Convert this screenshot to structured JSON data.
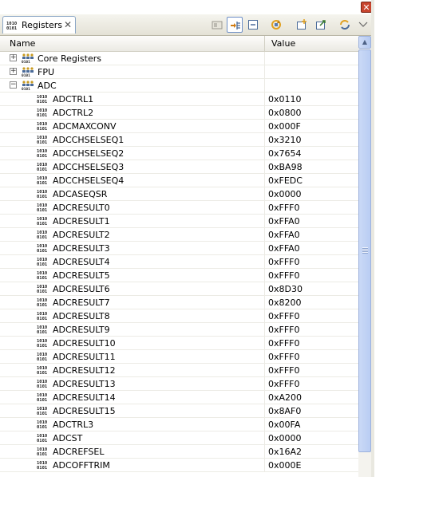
{
  "tab": {
    "label": "Registers",
    "close": "✕"
  },
  "window": {
    "close": "✕"
  },
  "columns": {
    "name": "Name",
    "value": "Value"
  },
  "rows": [
    {
      "name": "Core Registers",
      "value": "",
      "level": 0,
      "kind": "group",
      "state": "collapsed"
    },
    {
      "name": "FPU",
      "value": "",
      "level": 0,
      "kind": "group",
      "state": "collapsed"
    },
    {
      "name": "ADC",
      "value": "",
      "level": 0,
      "kind": "group",
      "state": "expanded"
    },
    {
      "name": "ADCTRL1",
      "value": "0x0110",
      "level": 1,
      "kind": "register"
    },
    {
      "name": "ADCTRL2",
      "value": "0x0800",
      "level": 1,
      "kind": "register"
    },
    {
      "name": "ADCMAXCONV",
      "value": "0x000F",
      "level": 1,
      "kind": "register"
    },
    {
      "name": "ADCCHSELSEQ1",
      "value": "0x3210",
      "level": 1,
      "kind": "register"
    },
    {
      "name": "ADCCHSELSEQ2",
      "value": "0x7654",
      "level": 1,
      "kind": "register"
    },
    {
      "name": "ADCCHSELSEQ3",
      "value": "0xBA98",
      "level": 1,
      "kind": "register"
    },
    {
      "name": "ADCCHSELSEQ4",
      "value": "0xFEDC",
      "level": 1,
      "kind": "register"
    },
    {
      "name": "ADCASEQSR",
      "value": "0x0000",
      "level": 1,
      "kind": "register"
    },
    {
      "name": "ADCRESULT0",
      "value": "0xFFF0",
      "level": 1,
      "kind": "register"
    },
    {
      "name": "ADCRESULT1",
      "value": "0xFFA0",
      "level": 1,
      "kind": "register"
    },
    {
      "name": "ADCRESULT2",
      "value": "0xFFA0",
      "level": 1,
      "kind": "register"
    },
    {
      "name": "ADCRESULT3",
      "value": "0xFFA0",
      "level": 1,
      "kind": "register"
    },
    {
      "name": "ADCRESULT4",
      "value": "0xFFF0",
      "level": 1,
      "kind": "register"
    },
    {
      "name": "ADCRESULT5",
      "value": "0xFFF0",
      "level": 1,
      "kind": "register"
    },
    {
      "name": "ADCRESULT6",
      "value": "0x8D30",
      "level": 1,
      "kind": "register"
    },
    {
      "name": "ADCRESULT7",
      "value": "0x8200",
      "level": 1,
      "kind": "register"
    },
    {
      "name": "ADCRESULT8",
      "value": "0xFFF0",
      "level": 1,
      "kind": "register"
    },
    {
      "name": "ADCRESULT9",
      "value": "0xFFF0",
      "level": 1,
      "kind": "register"
    },
    {
      "name": "ADCRESULT10",
      "value": "0xFFF0",
      "level": 1,
      "kind": "register"
    },
    {
      "name": "ADCRESULT11",
      "value": "0xFFF0",
      "level": 1,
      "kind": "register"
    },
    {
      "name": "ADCRESULT12",
      "value": "0xFFF0",
      "level": 1,
      "kind": "register"
    },
    {
      "name": "ADCRESULT13",
      "value": "0xFFF0",
      "level": 1,
      "kind": "register"
    },
    {
      "name": "ADCRESULT14",
      "value": "0xA200",
      "level": 1,
      "kind": "register"
    },
    {
      "name": "ADCRESULT15",
      "value": "0x8AF0",
      "level": 1,
      "kind": "register"
    },
    {
      "name": "ADCTRL3",
      "value": "0x00FA",
      "level": 1,
      "kind": "register"
    },
    {
      "name": "ADCST",
      "value": "0x0000",
      "level": 1,
      "kind": "register"
    },
    {
      "name": "ADCREFSEL",
      "value": "0x16A2",
      "level": 1,
      "kind": "register"
    },
    {
      "name": "ADCOFFTRIM",
      "value": "0x000E",
      "level": 1,
      "kind": "register"
    }
  ],
  "toolbar": [
    "layout-icon",
    "collapse-all-icon",
    "minimize-icon",
    "refresh-icon",
    "new-view-icon",
    "export-icon",
    "sync-icon",
    "view-menu-chevron-icon"
  ],
  "colors": {
    "tab_border": "#8ca7c6",
    "scrollbar": "#b9cdf3",
    "window_close": "#c8452f"
  }
}
